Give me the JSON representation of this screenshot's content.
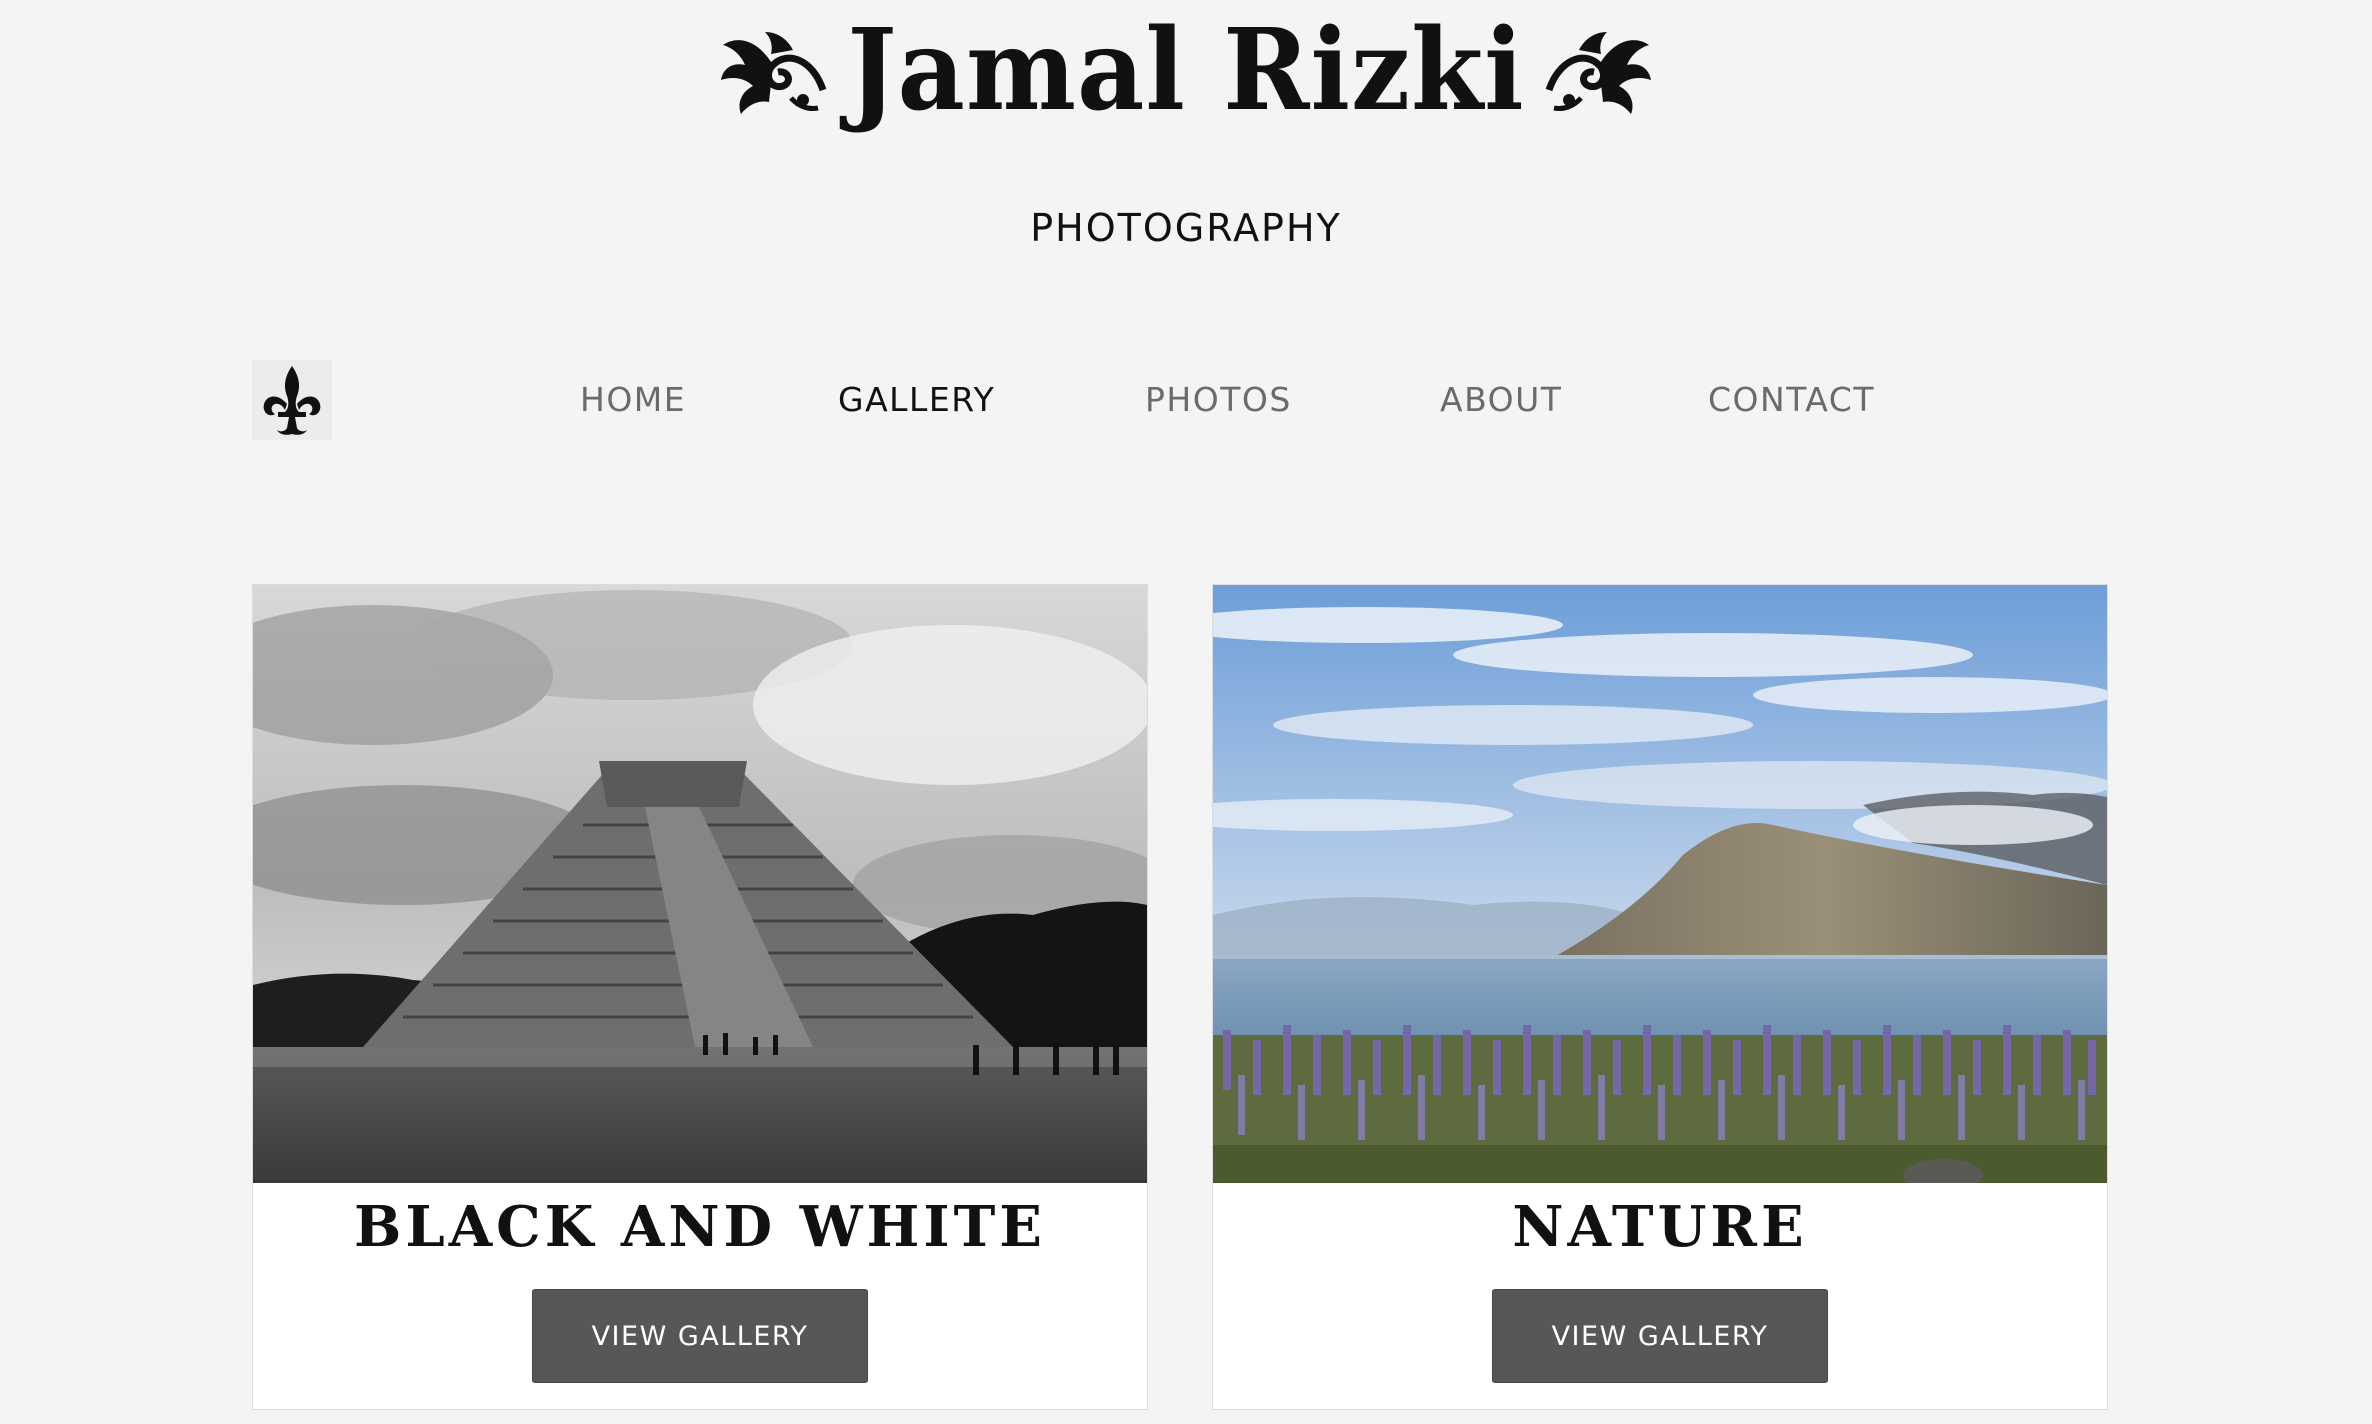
{
  "site": {
    "title": "Jamal Rizki",
    "subtitle": "PHOTOGRAPHY"
  },
  "icons": {
    "title_ornament": "floral-flourish-icon",
    "nav_logo": "fleur-de-lis-icon"
  },
  "nav": {
    "items": [
      {
        "label": "HOME",
        "active": false
      },
      {
        "label": "GALLERY",
        "active": true
      },
      {
        "label": "PHOTOS",
        "active": false
      },
      {
        "label": "ABOUT",
        "active": false
      },
      {
        "label": "CONTACT",
        "active": false
      }
    ]
  },
  "gallery": {
    "cards": [
      {
        "title": "BLACK AND WHITE",
        "button_label": "VIEW GALLERY"
      },
      {
        "title": "NATURE",
        "button_label": "VIEW GALLERY"
      }
    ]
  },
  "colors": {
    "background": "#f4f4f4",
    "text": "#111111",
    "nav_inactive": "#6b6b6b",
    "button": "#575757"
  }
}
